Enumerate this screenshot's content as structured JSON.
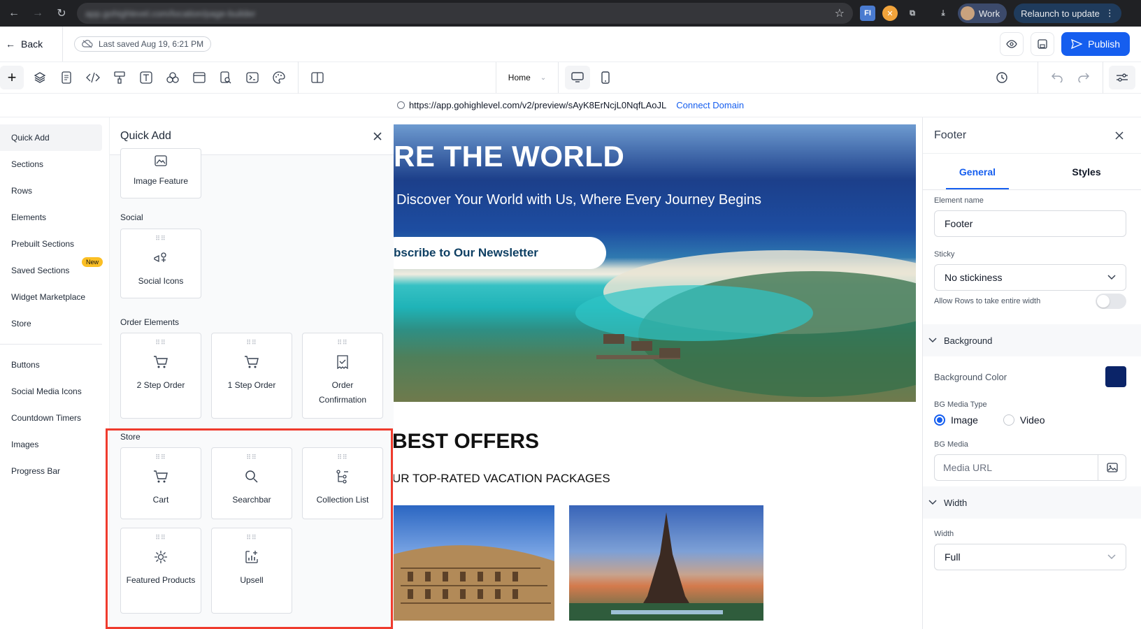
{
  "browser": {
    "url_blurred": "app.gohighlevel.com/location/page-builder",
    "profile_label": "Work",
    "relaunch_label": "Relaunch to update"
  },
  "header": {
    "back_label": "Back",
    "saved_label": "Last saved Aug 19, 6:21 PM",
    "publish_label": "Publish"
  },
  "toolbar": {
    "page_select": "Home"
  },
  "preview": {
    "url": "https://app.gohighlevel.com/v2/preview/sAyK8ErNcjL0NqfLAoJL",
    "connect_label": "Connect Domain"
  },
  "nav": {
    "items": [
      "Quick Add",
      "Sections",
      "Rows",
      "Elements",
      "Prebuilt Sections",
      "Saved Sections",
      "Widget Marketplace",
      "Store"
    ],
    "badge_new": "New",
    "items2": [
      "Buttons",
      "Social Media Icons",
      "Countdown Timers",
      "Images",
      "Progress Bar"
    ]
  },
  "quickadd": {
    "title": "Quick Add",
    "image_feature": "Image Feature",
    "social_title": "Social",
    "social_icons": "Social Icons",
    "order_title": "Order Elements",
    "order_items": [
      "2 Step Order",
      "1 Step Order",
      "Order Confirmation"
    ],
    "store_title": "Store",
    "store_items": [
      "Cart",
      "Searchbar",
      "Collection List",
      "Featured Products",
      "Upsell"
    ]
  },
  "canvas": {
    "hero_title": "RE THE WORLD",
    "hero_sub": "Discover Your World with Us, Where Every Journey Begins",
    "hero_cta": "bscribe to Our Newsletter",
    "offers_title": "BEST OFFERS",
    "offers_sub": "UR TOP-RATED VACATION PACKAGES"
  },
  "props": {
    "title": "Footer",
    "tab_general": "General",
    "tab_styles": "Styles",
    "element_name_label": "Element name",
    "element_name_value": "Footer",
    "sticky_label": "Sticky",
    "sticky_value": "No stickiness",
    "allow_rows_label": "Allow Rows to take entire width",
    "background_title": "Background",
    "bg_color_label": "Background Color",
    "bg_color_value": "#0b2468",
    "bg_media_type_label": "BG Media Type",
    "media_image": "Image",
    "media_video": "Video",
    "bg_media_label": "BG Media",
    "media_url_placeholder": "Media URL",
    "width_title": "Width",
    "width_label": "Width",
    "width_value": "Full"
  },
  "colors": {
    "accent": "#155eef",
    "highlight_box": "#ef3b2d"
  }
}
